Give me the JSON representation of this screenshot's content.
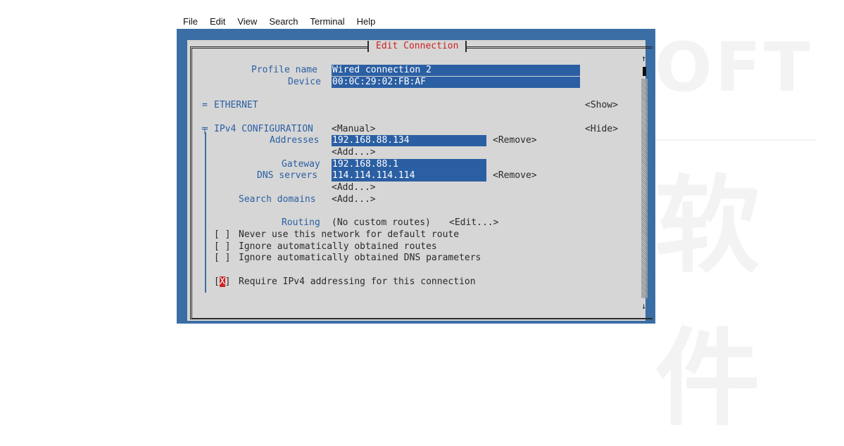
{
  "menu": [
    "File",
    "Edit",
    "View",
    "Search",
    "Terminal",
    "Help"
  ],
  "dialog_title": "Edit Connection",
  "profile": {
    "label": "Profile name",
    "value": "Wired connection 2"
  },
  "device": {
    "label": "Device",
    "value": "00:0C:29:02:FB:AF"
  },
  "ethernet": {
    "marker": "=",
    "label": "ETHERNET",
    "toggle": "<Show>"
  },
  "ipv4": {
    "marker": "╤",
    "label": "IPv4 CONFIGURATION",
    "mode": "<Manual>",
    "toggle": "<Hide>",
    "addresses_label": "Addresses",
    "address": "192.168.88.134",
    "remove": "<Remove>",
    "add": "<Add...>",
    "gateway_label": "Gateway",
    "gateway": "192.168.88.1",
    "dns_label": "DNS servers",
    "dns": "114.114.114.114",
    "search_label": "Search domains",
    "routing_label": "Routing",
    "routing_value": "(No custom routes)",
    "edit": "<Edit...>"
  },
  "options": [
    {
      "box": "[ ]",
      "label": "Never use this network for default route"
    },
    {
      "box": "[ ]",
      "label": "Ignore automatically obtained routes"
    },
    {
      "box": "[ ]",
      "label": "Ignore automatically obtained DNS parameters"
    }
  ],
  "require": {
    "open": "[",
    "mark": "X",
    "close": "]",
    "label": "Require IPv4 addressing for this connection"
  },
  "scrollbar": {
    "up": "↑",
    "down": "↓"
  },
  "watermark": {
    "top": "OFT",
    "bottom": "软件"
  }
}
